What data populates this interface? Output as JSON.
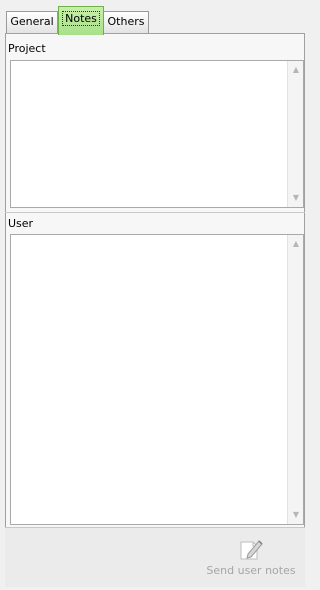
{
  "tabs": {
    "general": "General",
    "notes": "Notes",
    "others": "Others"
  },
  "project": {
    "label": "Project",
    "value": ""
  },
  "user": {
    "label": "User",
    "value": ""
  },
  "footer": {
    "send_label": "Send user notes"
  },
  "icons": {
    "send": "edit-notes-icon",
    "scroll_up": "scroll-up-icon",
    "scroll_down": "scroll-down-icon"
  },
  "colors": {
    "active_tab": "#a8e08a",
    "disabled_text": "#a6a6a6"
  }
}
